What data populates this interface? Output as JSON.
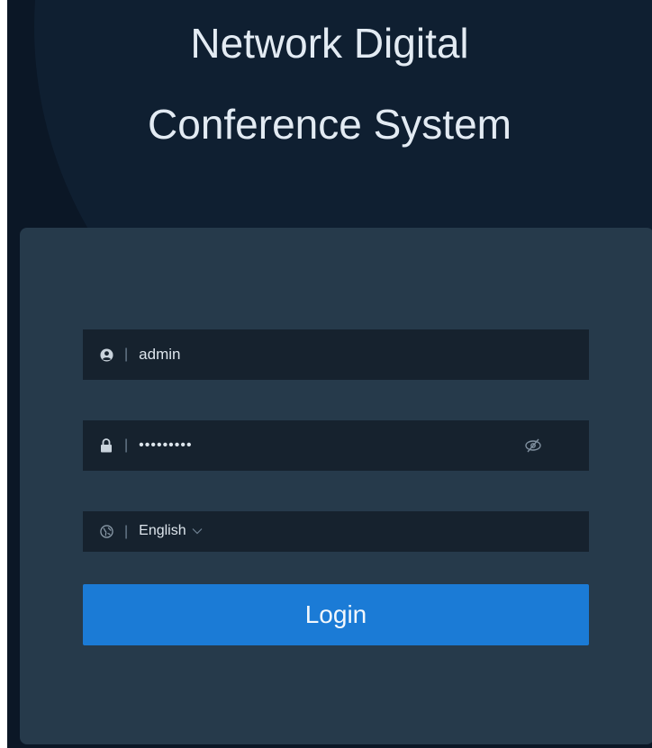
{
  "app": {
    "title_line1": "Network Digital",
    "title_line2": "Conference System"
  },
  "form": {
    "username": {
      "value": "admin",
      "icon": "user-icon"
    },
    "password": {
      "value": "•••••••••",
      "icon": "lock-icon",
      "toggle_icon": "eye-slash-icon"
    },
    "language": {
      "value": "English",
      "icon": "globe-icon"
    },
    "login_label": "Login"
  },
  "colors": {
    "background": "#0b1726",
    "card": "#263a4b",
    "field": "#16222e",
    "accent": "#1b7bd6"
  }
}
